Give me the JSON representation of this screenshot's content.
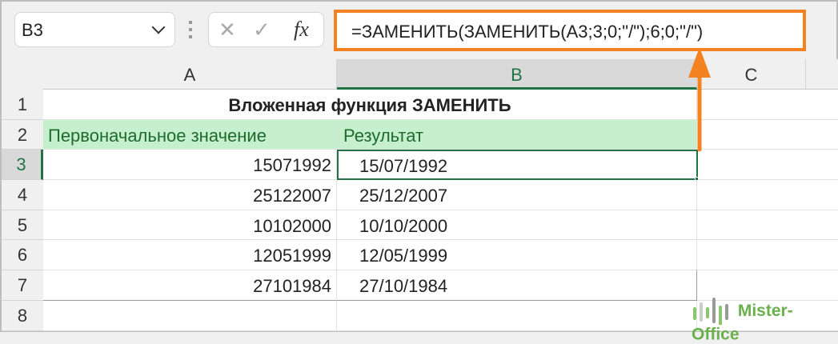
{
  "name_box": {
    "value": "B3"
  },
  "formula_bar": {
    "cancel_icon": "✕",
    "enter_icon": "✓",
    "fx_label": "fx",
    "formula": "=ЗАМЕНИТЬ(ЗАМЕНИТЬ(A3;3;0;\"/\");6;0;\"/\")"
  },
  "columns": [
    "A",
    "B",
    "C"
  ],
  "rows": [
    "1",
    "2",
    "3",
    "4",
    "5",
    "6",
    "7",
    "8"
  ],
  "title": "Вложенная функция ЗАМЕНИТЬ",
  "headers": {
    "a": "Первоначальное значение",
    "b": "Результат"
  },
  "data": [
    {
      "a": "15071992",
      "b": "15/07/1992"
    },
    {
      "a": "25122007",
      "b": "25/12/2007"
    },
    {
      "a": "10102000",
      "b": "10/10/2000"
    },
    {
      "a": "12051999",
      "b": "12/05/1999"
    },
    {
      "a": "27101984",
      "b": "27/10/1984"
    }
  ],
  "watermark": "Mister-Office",
  "colors": {
    "accent": "#f58220",
    "excel_green": "#217346",
    "header_fill": "#c6efce"
  }
}
